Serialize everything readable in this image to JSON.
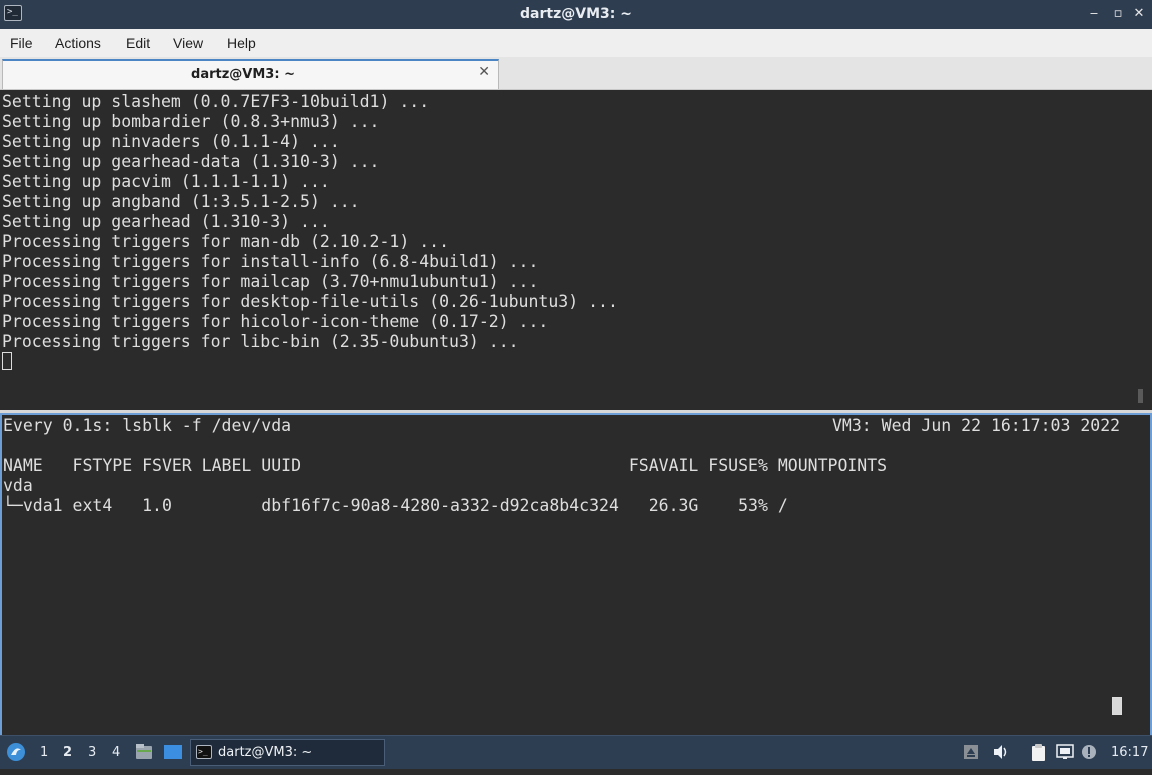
{
  "window": {
    "title": "dartz@VM3: ~",
    "buttons": {
      "minimize": "‒",
      "maximize": "▫",
      "close": "✕"
    }
  },
  "menu": {
    "items": [
      "File",
      "Actions",
      "Edit",
      "View",
      "Help"
    ]
  },
  "tabs": [
    {
      "label": "dartz@VM3: ~",
      "close": "✕"
    }
  ],
  "terminal_top": {
    "lines": [
      "Setting up slashem (0.0.7E7F3-10build1) ...",
      "Setting up bombardier (0.8.3+nmu3) ...",
      "Setting up ninvaders (0.1.1-4) ...",
      "Setting up gearhead-data (1.310-3) ...",
      "Setting up pacvim (1.1.1-1.1) ...",
      "Setting up angband (1:3.5.1-2.5) ...",
      "Setting up gearhead (1.310-3) ...",
      "Processing triggers for man-db (2.10.2-1) ...",
      "Processing triggers for install-info (6.8-4build1) ...",
      "Processing triggers for mailcap (3.70+nmu1ubuntu1) ...",
      "Processing triggers for desktop-file-utils (0.26-1ubuntu3) ...",
      "Processing triggers for hicolor-icon-theme (0.17-2) ...",
      "Processing triggers for libc-bin (2.35-0ubuntu3) ..."
    ]
  },
  "terminal_bottom": {
    "watch_header": "Every 0.1s: lsblk -f /dev/vda",
    "watch_status": "VM3: Wed Jun 22 16:17:03 2022",
    "lines": [
      "NAME   FSTYPE FSVER LABEL UUID                                 FSAVAIL FSUSE% MOUNTPOINTS",
      "vda",
      "└─vda1 ext4   1.0         dbf16f7c-90a8-4280-a332-d92ca8b4c324   26.3G    53% /"
    ]
  },
  "taskbar": {
    "workspaces": [
      "1",
      "2",
      "3",
      "4"
    ],
    "active_workspace": "2",
    "task_label": "dartz@VM3: ~",
    "clock": "16:17",
    "icons": [
      "start-menu-icon",
      "file-manager-icon",
      "show-desktop-icon",
      "terminal-icon",
      "eject-icon",
      "volume-icon",
      "clipboard-icon",
      "network-icon",
      "notification-icon"
    ]
  }
}
